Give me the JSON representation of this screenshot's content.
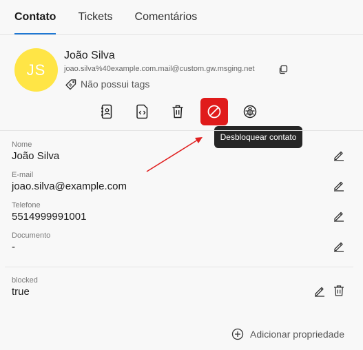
{
  "tabs": [
    {
      "label": "Contato",
      "active": true
    },
    {
      "label": "Tickets",
      "active": false
    },
    {
      "label": "Comentários",
      "active": false
    }
  ],
  "contact": {
    "initials": "JS",
    "name": "João Silva",
    "email": "joao.silva%40example.com.mail@custom.gw.msging.net",
    "tags_label": "Não possui tags",
    "avatar_color": "#ffe546"
  },
  "actions": [
    {
      "icon": "contact-book-icon"
    },
    {
      "icon": "code-file-icon"
    },
    {
      "icon": "trash-icon"
    },
    {
      "icon": "block-icon",
      "active": true
    },
    {
      "icon": "bug-icon"
    }
  ],
  "tooltip": "Desbloquear contato",
  "fields": [
    {
      "label": "Nome",
      "value": "João Silva"
    },
    {
      "label": "E-mail",
      "value": "joao.silva@example.com"
    },
    {
      "label": "Telefone",
      "value": "5514999991001"
    },
    {
      "label": "Documento",
      "value": "-"
    }
  ],
  "custom_fields": [
    {
      "label": "blocked",
      "value": "true"
    }
  ],
  "add_property_label": "Adicionar propriedade",
  "colors": {
    "accent": "#1e78d4",
    "danger": "#e01b1b",
    "tooltip_bg": "#262626",
    "annotation_arrow": "#e02020"
  }
}
